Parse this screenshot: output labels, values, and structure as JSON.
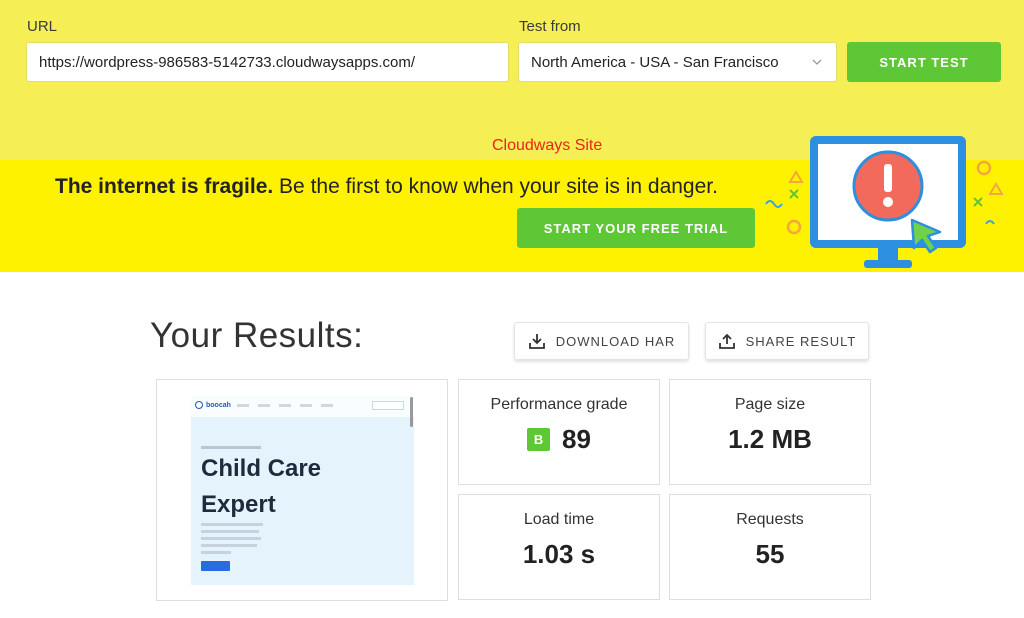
{
  "form": {
    "url_label": "URL",
    "url_value": "https://wordpress-986583-5142733.cloudwaysapps.com/",
    "test_from_label": "Test from",
    "location_value": "North America - USA - San Francisco",
    "start_test_label": "START TEST"
  },
  "promo": {
    "site_label": "Cloudways Site",
    "headline_bold": "The internet is fragile.",
    "headline_rest": " Be the first to know when your site is in danger.",
    "trial_button": "START YOUR FREE TRIAL"
  },
  "results": {
    "title": "Your Results:",
    "download_har": "DOWNLOAD HAR",
    "share_result": "SHARE RESULT",
    "screenshot": {
      "brand": "boocah",
      "heading": "Child Care Expert"
    },
    "stats": [
      {
        "label": "Performance grade",
        "grade": "B",
        "value": "89"
      },
      {
        "label": "Page size",
        "value": "1.2 MB"
      },
      {
        "label": "Load time",
        "value": "1.03 s"
      },
      {
        "label": "Requests",
        "value": "55"
      }
    ]
  },
  "colors": {
    "top_band": "#f5ee55",
    "promo_band": "#fff200",
    "accent_green": "#5ec736",
    "site_label_red": "#e8261b"
  }
}
